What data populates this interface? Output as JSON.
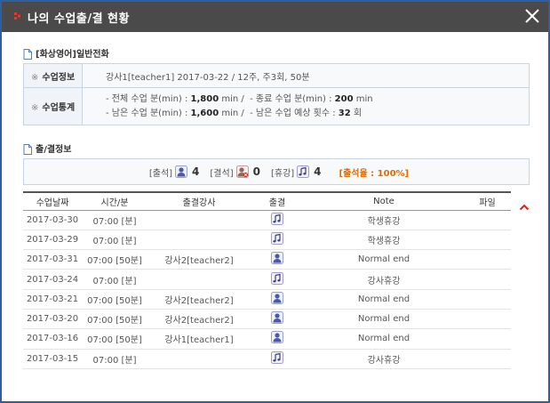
{
  "window": {
    "title": "나의 수업출/결 현황"
  },
  "course": {
    "heading": "[화상영어]일반전화"
  },
  "info": {
    "class_info_label": "수업정보",
    "class_info_value": "강사1[teacher1] 2017-03-22 / 12주, 주3회, 50분",
    "stats_label": "수업통계",
    "stats": {
      "total_prefix": "- 전체 수업 분(min) : ",
      "total_value": "1,800",
      "total_suffix": " min /",
      "ended_prefix": "- 종료 수업 분(min) : ",
      "ended_value": "200",
      "ended_suffix": " min",
      "remain_prefix": "- 남은 수업 분(min) : ",
      "remain_value": "1,600",
      "remain_suffix": " min /",
      "expected_prefix": "- 남은 수업 예상 횟수 : ",
      "expected_value": "32",
      "expected_suffix": " 회"
    }
  },
  "attendance": {
    "heading": "출/결정보",
    "present_label": "[출석]",
    "present_count": "4",
    "absent_label": "[결석]",
    "absent_count": "0",
    "holiday_label": "[휴강]",
    "holiday_count": "4",
    "rate": "[출석율 : 100%]"
  },
  "table": {
    "headers": [
      "수업날짜",
      "시간/분",
      "출결강사",
      "출결",
      "Note",
      "파일"
    ],
    "rows": [
      {
        "date": "2017-03-30",
        "time": "07:00 [분]",
        "teacher": "",
        "status": "holiday",
        "note": "학생휴강"
      },
      {
        "date": "2017-03-29",
        "time": "07:00 [분]",
        "teacher": "",
        "status": "holiday",
        "note": "학생휴강"
      },
      {
        "date": "2017-03-31",
        "time": "07:00 [50분]",
        "teacher": "강사2[teacher2]",
        "status": "present",
        "note": "Normal end"
      },
      {
        "date": "2017-03-24",
        "time": "07:00 [분]",
        "teacher": "",
        "status": "holiday",
        "note": "강사휴강"
      },
      {
        "date": "2017-03-21",
        "time": "07:00 [50분]",
        "teacher": "강사2[teacher2]",
        "status": "present",
        "note": "Normal end"
      },
      {
        "date": "2017-03-20",
        "time": "07:00 [50분]",
        "teacher": "강사2[teacher2]",
        "status": "present",
        "note": "Normal end"
      },
      {
        "date": "2017-03-16",
        "time": "07:00 [50분]",
        "teacher": "강사1[teacher1]",
        "status": "present",
        "note": "Normal end"
      },
      {
        "date": "2017-03-15",
        "time": "07:00 [분]",
        "teacher": "",
        "status": "holiday",
        "note": "강사휴강"
      }
    ]
  },
  "icons": {
    "title_dot": "red-dots-icon",
    "close": "close-icon",
    "doc": "document-icon",
    "present": "person-icon",
    "absent": "person-x-icon",
    "holiday": "music-note-icon",
    "sort": "chevron-up-icon"
  },
  "colors": {
    "titlebar": "#4a4a4a",
    "frame_border": "#2f5f9c",
    "accent_red": "#d9261c",
    "rate_orange": "#e06b00"
  }
}
